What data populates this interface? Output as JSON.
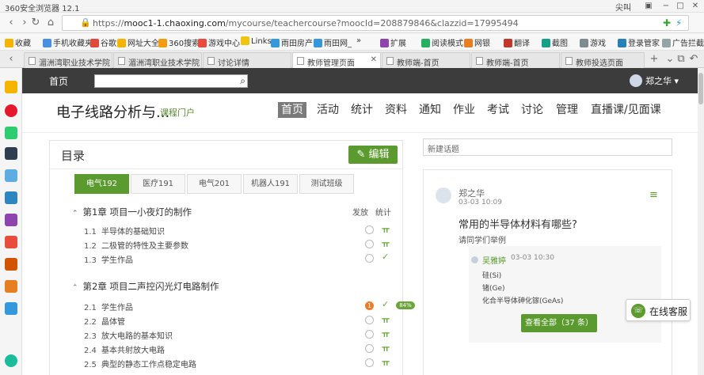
{
  "browser": {
    "app_title": "360安全浏览器 12.1",
    "title_right": "尖叫",
    "url_prefix": "https://",
    "url_host": "mooc1-1.chaoxing.com",
    "url_path": "/mycourse/teachercourse?moocId=208879846&clazzid=17995494",
    "bookmarks": [
      "收藏",
      "手机收藏夹",
      "谷歌",
      "网址大全",
      "360搜索",
      "游戏中心",
      "Links",
      "雨田房产",
      "雨田网_",
      "»",
      "扩展",
      "阅读模式",
      "网银",
      "翻译",
      "截图",
      "游戏",
      "登录管家",
      "广告拦截"
    ],
    "tabs": [
      "湄洲湾职业技术学院",
      "湄洲湾职业技术学院",
      "讨论详情",
      "教师管理页面",
      "教师端-首页",
      "教师端-首页",
      "教师投选页面"
    ]
  },
  "topnav": {
    "home": "首页",
    "user": "郑之华"
  },
  "course": {
    "title": "电子线路分析与...",
    "portal": "课程门户",
    "nav": [
      "首页",
      "活动",
      "统计",
      "资料",
      "通知",
      "作业",
      "考试",
      "讨论",
      "管理",
      "直播课/见面课"
    ]
  },
  "catalog": {
    "heading": "目录",
    "edit_label": "编辑",
    "class_tabs": [
      "电气192",
      "医疗191",
      "电气201",
      "机器人191",
      "测试班级"
    ],
    "col_publish": "发放",
    "col_stats": "统计",
    "chapters": [
      {
        "label": "第1章 项目一小夜灯的制作",
        "sections": [
          {
            "num": "1.1",
            "title": "半导体的基础知识"
          },
          {
            "num": "1.2",
            "title": "二极管的特性及主要参数"
          },
          {
            "num": "1.3",
            "title": "学生作品"
          }
        ]
      },
      {
        "label": "第2章 项目二声控闪光灯电路制作",
        "sections": [
          {
            "num": "2.1",
            "title": "学生作品",
            "badge": "1",
            "percent": "84%"
          },
          {
            "num": "2.2",
            "title": "晶体管"
          },
          {
            "num": "2.3",
            "title": "放大电路的基本知识"
          },
          {
            "num": "2.4",
            "title": "基本共射放大电路"
          },
          {
            "num": "2.5",
            "title": "典型的静态工作点稳定电路"
          }
        ]
      }
    ]
  },
  "discussion": {
    "new_topic_placeholder": "新建话题",
    "author": "郑之华",
    "time": "03-03 10:09",
    "question": "常用的半导体材料有哪些?",
    "prompt": "请同学们举例",
    "reply": {
      "author": "吴雅婷",
      "time": "03-03 10:30",
      "lines": [
        "硅(Si)",
        "锗(Ge)",
        "化合半导体砷化镓(GeAs)"
      ]
    },
    "view_all": "查看全部（37 条）"
  },
  "service": {
    "label": "在线客服"
  }
}
